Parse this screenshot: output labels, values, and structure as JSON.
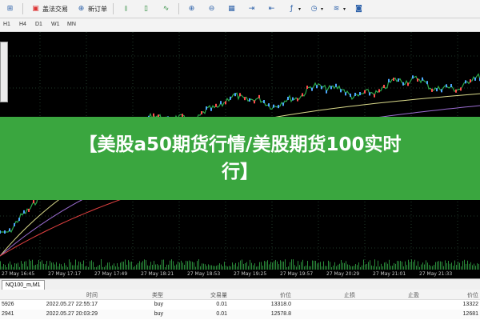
{
  "toolbar": {
    "items": [
      {
        "label": "",
        "icon": "new-chart-icon"
      },
      {
        "label": "盖法交易",
        "icon": "algo-trading-icon"
      },
      {
        "label": "新订单",
        "icon": "new-order-icon"
      },
      {
        "label": "",
        "icon": "bar-chart-icon"
      },
      {
        "label": "",
        "icon": "candlestick-icon"
      },
      {
        "label": "",
        "icon": "line-chart-icon"
      },
      {
        "label": "",
        "icon": "zoom-in-icon"
      },
      {
        "label": "",
        "icon": "zoom-out-icon"
      },
      {
        "label": "",
        "icon": "tile-windows-icon"
      },
      {
        "label": "",
        "icon": "autoscroll-icon"
      },
      {
        "label": "",
        "icon": "chart-shift-icon"
      },
      {
        "label": "",
        "icon": "indicators-icon"
      },
      {
        "label": "",
        "icon": "periods-icon"
      },
      {
        "label": "",
        "icon": "templates-icon"
      },
      {
        "label": "",
        "icon": "screenshot-icon"
      }
    ]
  },
  "periods": [
    "H1",
    "H4",
    "D1",
    "W1",
    "MN"
  ],
  "chart": {
    "background": "#000000",
    "price_color": "#2aa84a",
    "time_labels": [
      "27 May 16:45",
      "27 May 17:17",
      "27 May 17:49",
      "27 May 18:21",
      "27 May 18:53",
      "27 May 19:25",
      "27 May 19:57",
      "27 May 20:29",
      "27 May 21:01",
      "27 May 21:33"
    ]
  },
  "banner": {
    "text": "【美股a50期货行情/美股期货100实时行】",
    "background": "#3aa63f"
  },
  "tab": {
    "label": "NQ100_m,M1"
  },
  "table": {
    "columns": [
      "",
      "时间",
      "类型",
      "交易量",
      "价位",
      "止损",
      "止盈",
      "价位"
    ],
    "rows": [
      [
        "5926",
        "2022.05.27 22:55:17",
        "buy",
        "0.01",
        "13318.0",
        "",
        "",
        "13322"
      ],
      [
        "2941",
        "2022.05.27 20:03:29",
        "buy",
        "0.01",
        "12578.8",
        "",
        "",
        "12681"
      ]
    ]
  }
}
